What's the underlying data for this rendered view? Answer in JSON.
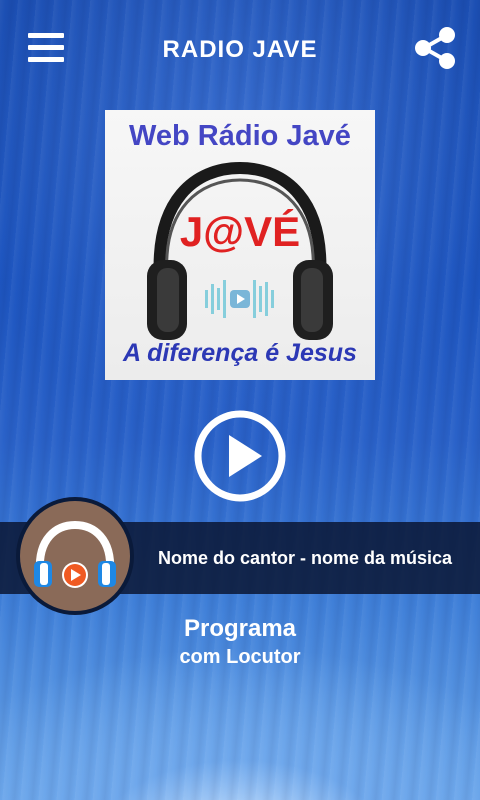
{
  "header": {
    "title": "RADIO JAVE",
    "menu_icon": "hamburger-menu-icon",
    "share_icon": "share-icon"
  },
  "cover": {
    "top_text": "Web Rádio Javé",
    "brand_text": "J@VÉ",
    "tagline": "A diferença é Jesus"
  },
  "player": {
    "play_icon": "play-icon",
    "now_playing": "Nome do cantor - nome da música"
  },
  "program": {
    "title": "Programa",
    "announcer": "com Locutor"
  },
  "colors": {
    "accent_white": "#ffffff",
    "cover_blue": "#4446c4",
    "cover_red": "#e02222",
    "logo_orange": "#f05a22",
    "logo_blue": "#1e88e5"
  }
}
